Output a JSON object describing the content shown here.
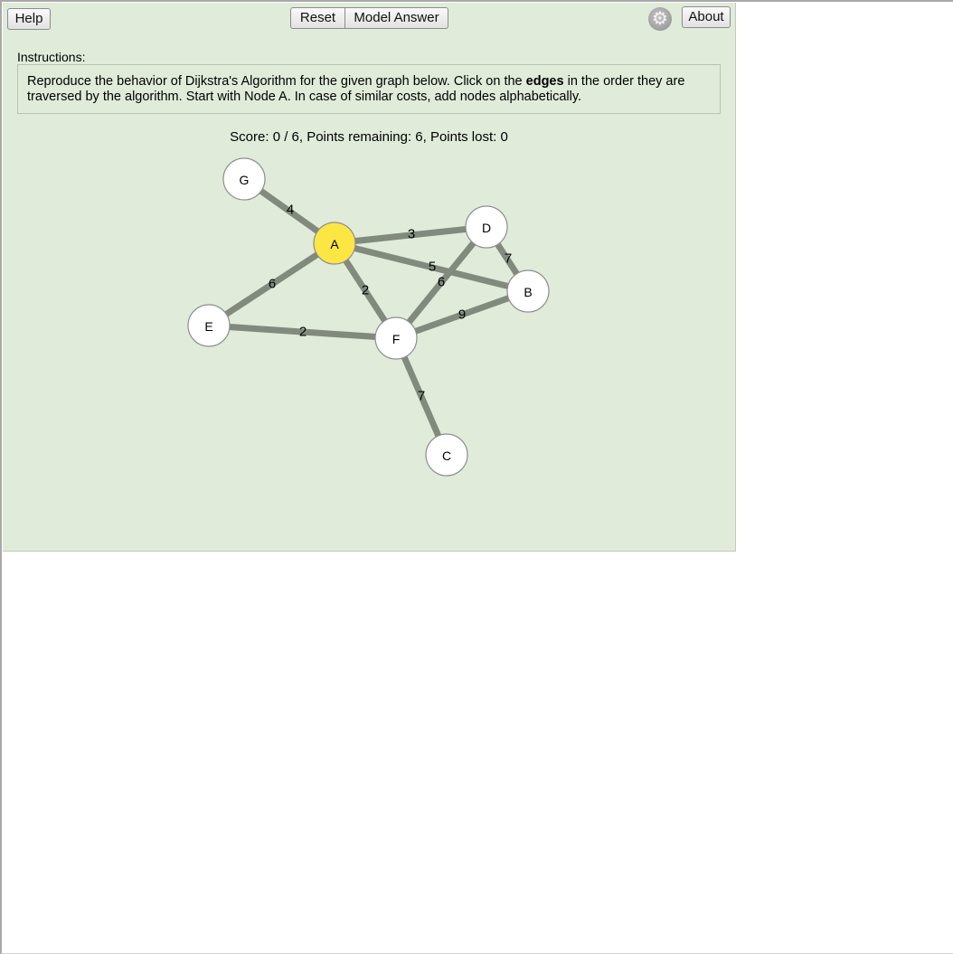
{
  "toolbar": {
    "help_label": "Help",
    "reset_label": "Reset",
    "model_answer_label": "Model Answer",
    "about_label": "About",
    "settings_icon": "gear-icon"
  },
  "instructions": {
    "label": "Instructions:",
    "text_before": "Reproduce the behavior of Dijkstra's Algorithm for the given graph below. Click on the ",
    "text_bold": "edges",
    "text_after": " in the order they are traversed by the algorithm. Start with Node A. In case of similar costs, add nodes alphabetically."
  },
  "score": {
    "text": "Score: 0 / 6, Points remaining: 6, Points lost: 0"
  },
  "graph": {
    "start_node": "A",
    "nodes": [
      {
        "id": "G",
        "label": "G",
        "highlighted": false
      },
      {
        "id": "A",
        "label": "A",
        "highlighted": true
      },
      {
        "id": "D",
        "label": "D",
        "highlighted": false
      },
      {
        "id": "B",
        "label": "B",
        "highlighted": false
      },
      {
        "id": "E",
        "label": "E",
        "highlighted": false
      },
      {
        "id": "F",
        "label": "F",
        "highlighted": false
      },
      {
        "id": "C",
        "label": "C",
        "highlighted": false
      }
    ],
    "edges": [
      {
        "from": "A",
        "to": "G",
        "weight": "4"
      },
      {
        "from": "A",
        "to": "D",
        "weight": "3"
      },
      {
        "from": "A",
        "to": "B",
        "weight": "5"
      },
      {
        "from": "A",
        "to": "E",
        "weight": "6"
      },
      {
        "from": "A",
        "to": "F",
        "weight": "2"
      },
      {
        "from": "D",
        "to": "B",
        "weight": "7"
      },
      {
        "from": "D",
        "to": "F",
        "weight": "6"
      },
      {
        "from": "B",
        "to": "F",
        "weight": "9"
      },
      {
        "from": "E",
        "to": "F",
        "weight": "2"
      },
      {
        "from": "F",
        "to": "C",
        "weight": "7"
      }
    ]
  },
  "colors": {
    "background": "#e0ebda",
    "edge": "#818a7d",
    "node_fill": "#ffffff",
    "node_highlight": "#fce644"
  }
}
